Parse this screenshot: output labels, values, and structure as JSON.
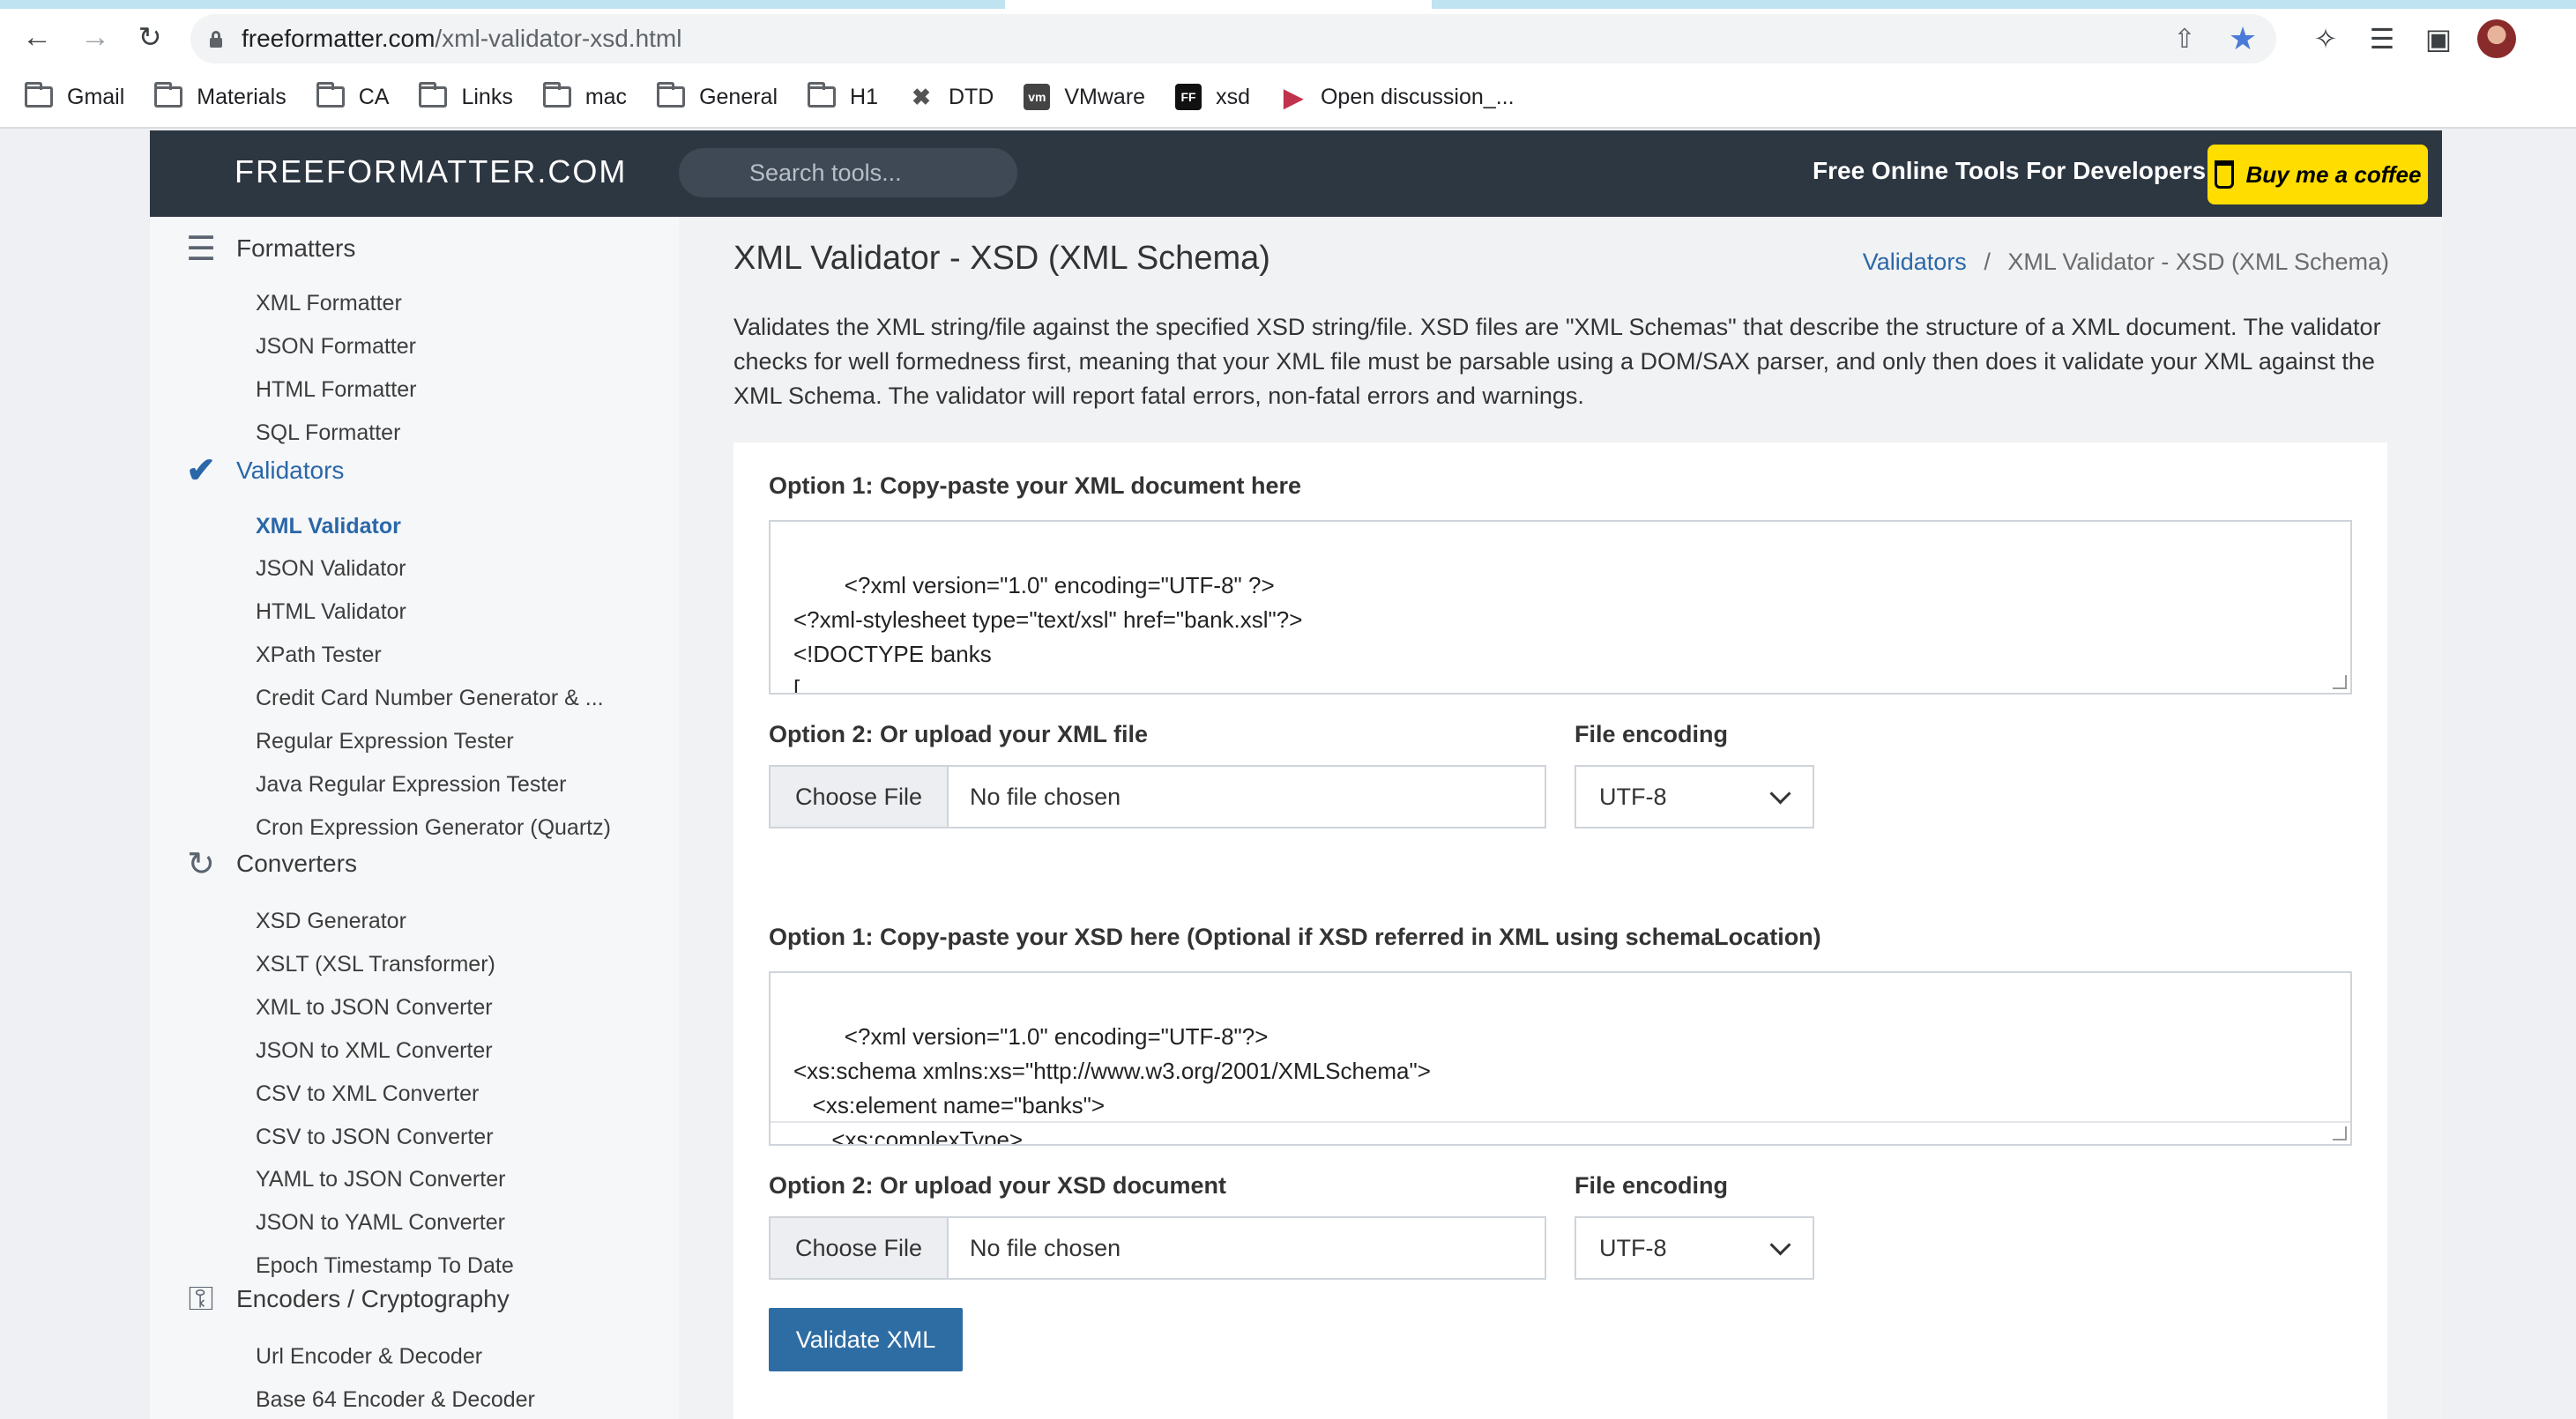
{
  "browser": {
    "url_host": "freeformatter.com",
    "url_path": "/xml-validator-xsd.html",
    "bookmarks": [
      {
        "label": "Gmail",
        "icon": "folder-icon"
      },
      {
        "label": "Materials",
        "icon": "folder-icon"
      },
      {
        "label": "CA",
        "icon": "folder-icon"
      },
      {
        "label": "Links",
        "icon": "folder-icon"
      },
      {
        "label": "mac",
        "icon": "folder-icon"
      },
      {
        "label": "General",
        "icon": "folder-icon"
      },
      {
        "label": "H1",
        "icon": "folder-icon"
      },
      {
        "label": "DTD",
        "icon": "dtd-icon"
      },
      {
        "label": "VMware",
        "icon": "vmware-icon"
      },
      {
        "label": "xsd",
        "icon": "ff-icon"
      },
      {
        "label": "Open discussion_...",
        "icon": "play-icon"
      }
    ]
  },
  "header": {
    "logo": "FREEFORMATTER.COM",
    "search_placeholder": "Search tools...",
    "tagline": "Free Online Tools For Developers",
    "coffee": "Buy me a coffee"
  },
  "sidebar": {
    "categories": [
      {
        "label": "Formatters",
        "icon": "list-indent-icon",
        "items": [
          "XML Formatter",
          "JSON Formatter",
          "HTML Formatter",
          "SQL Formatter"
        ]
      },
      {
        "label": "Validators",
        "icon": "checkmarks-icon",
        "items": [
          "XML Validator",
          "JSON Validator",
          "HTML Validator",
          "XPath Tester",
          "Credit Card Number Generator & ...",
          "Regular Expression Tester",
          "Java Regular Expression Tester",
          "Cron Expression Generator (Quartz)"
        ]
      },
      {
        "label": "Converters",
        "icon": "refresh-icon",
        "items": [
          "XSD Generator",
          "XSLT (XSL Transformer)",
          "XML to JSON Converter",
          "JSON to XML Converter",
          "CSV to XML Converter",
          "CSV to JSON Converter",
          "YAML to JSON Converter",
          "JSON to YAML Converter",
          "Epoch Timestamp To Date"
        ]
      },
      {
        "label": "Encoders / Cryptography",
        "icon": "key-icon",
        "items": [
          "Url Encoder & Decoder",
          "Base 64 Encoder & Decoder"
        ]
      }
    ]
  },
  "main": {
    "title": "XML Validator - XSD (XML Schema)",
    "breadcrumb_link": "Validators",
    "breadcrumb_sep": "/",
    "breadcrumb_current": "XML Validator - XSD (XML Schema)",
    "description": "Validates the XML string/file against the specified XSD string/file. XSD files are \"XML Schemas\" that describe the structure of a XML document. The validator checks for well formedness first, meaning that your XML file must be parsable using a DOM/SAX parser, and only then does it validate your XML against the XML Schema. The validator will report fatal errors, non-fatal errors and warnings.",
    "xml_option1_label": "Option 1: Copy-paste your XML document here",
    "xml_code": "<?xml version=\"1.0\" encoding=\"UTF-8\" ?>\n<?xml-stylesheet type=\"text/xsl\" href=\"bank.xsl\"?>\n<!DOCTYPE banks\n[\n<!ELEMENT banks (bank+)>",
    "xml_option2_label": "Option 2: Or upload your XML file",
    "xml_encoding_label": "File encoding",
    "choose_file": "Choose File",
    "no_file": "No file chosen",
    "encoding_value": "UTF-8",
    "xsd_option1_label": "Option 1: Copy-paste your XSD here (Optional if XSD referred in XML using schemaLocation)",
    "xsd_code": "<?xml version=\"1.0\" encoding=\"UTF-8\"?>\n<xs:schema xmlns:xs=\"http://www.w3.org/2001/XMLSchema\">\n   <xs:element name=\"banks\">\n      <xs:complexType>\n         <xs:sequence>",
    "xsd_option2_label": "Option 2: Or upload your XSD document",
    "xsd_encoding_label": "File encoding",
    "validate_button": "Validate XML"
  }
}
